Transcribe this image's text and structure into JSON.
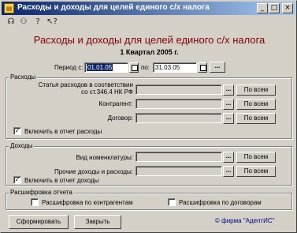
{
  "window": {
    "title": "Расходы и доходы для целей единого с/х налога",
    "title_icon": "form-icon",
    "controls": [
      "_",
      "□",
      "×"
    ]
  },
  "toolbar": {
    "icons": [
      "run-icon",
      "users-icon",
      "help-icon",
      "pointer-help-icon"
    ],
    "glyphs": [
      "☊",
      "⚇",
      "?",
      "↖?"
    ]
  },
  "heading": "Расходы и доходы для целей единого с/х налога",
  "subheading": "1 Квартал 2005 г.",
  "period": {
    "label_from": "Период с:",
    "date_from": "01.01.05",
    "label_to": "по:",
    "date_to": "31.03.05",
    "more": "..."
  },
  "expenses": {
    "title": "Расходы",
    "article_label_1": "Статья расходов в соответствии",
    "article_label_2": "со ст.346.4 НК РФ",
    "counterparty_label": "Контрагент:",
    "contract_label": "Договор:",
    "dots": "...",
    "all_label": "По всем",
    "include_label": "Включить в отчет расходы",
    "include_checked": true
  },
  "income": {
    "title": "Доходы",
    "nomenclature_label": "Вид номенклатуры:",
    "other_label": "Прочие доходы и расходы:",
    "dots": "...",
    "all_label": "По всем",
    "include_label": "Включить в отчет доходы",
    "include_checked": true
  },
  "breakdown": {
    "title": "Расшифровка отчета",
    "by_counterparty": "Расшифровка по контрагентам",
    "by_contract": "Расшифровка по договорам",
    "by_counterparty_checked": false,
    "by_contract_checked": false
  },
  "footer": {
    "form_label": "Сформировать",
    "close_label": "Закрыть",
    "copyright": "© фирма \"АдептИС\""
  }
}
